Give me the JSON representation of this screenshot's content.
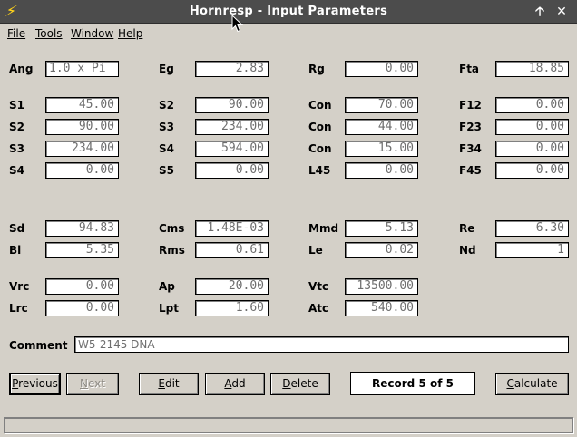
{
  "window": {
    "title": "Hornresp - Input Parameters",
    "maximize_glyph": "🡡",
    "close_glyph": "✕"
  },
  "menu": [
    "File",
    "Tools",
    "Window",
    "Help"
  ],
  "fields": {
    "Ang": "1.0 x Pi",
    "Eg": "2.83",
    "Rg": "0.00",
    "Fta": "18.85",
    "S1": "45.00",
    "S2a": "90.00",
    "Con1": "70.00",
    "F12": "0.00",
    "S2": "90.00",
    "S3a": "234.00",
    "Con2": "44.00",
    "F23": "0.00",
    "S3": "234.00",
    "S4a": "594.00",
    "Con3": "15.00",
    "F34": "0.00",
    "S4": "0.00",
    "S5": "0.00",
    "L45": "0.00",
    "F45": "0.00",
    "Sd": "94.83",
    "Cms": "1.48E-03",
    "Mmd": "5.13",
    "Re": "6.30",
    "Bl": "5.35",
    "Rms": "0.61",
    "Le": "0.02",
    "Nd": "1",
    "Vrc": "0.00",
    "Ap": "20.00",
    "Vtc": "13500.00",
    "Lrc": "0.00",
    "Lpt": "1.60",
    "Atc": "540.00",
    "Comment": "W5-2145 DNA"
  },
  "labels": {
    "Ang": "Ang",
    "Eg": "Eg",
    "Rg": "Rg",
    "Fta": "Fta",
    "S1": "S1",
    "S2a": "S2",
    "Con1": "Con",
    "F12": "F12",
    "S2": "S2",
    "S3a": "S3",
    "Con2": "Con",
    "F23": "F23",
    "S3": "S3",
    "S4a": "S4",
    "Con3": "Con",
    "F34": "F34",
    "S4": "S4",
    "S5": "S5",
    "L45": "L45",
    "F45": "F45",
    "Sd": "Sd",
    "Cms": "Cms",
    "Mmd": "Mmd",
    "Re": "Re",
    "Bl": "Bl",
    "Rms": "Rms",
    "Le": "Le",
    "Nd": "Nd",
    "Vrc": "Vrc",
    "Ap": "Ap",
    "Vtc": "Vtc",
    "Lrc": "Lrc",
    "Lpt": "Lpt",
    "Atc": "Atc",
    "Comment": "Comment"
  },
  "buttons": {
    "previous": {
      "u": "P",
      "rest": "revious"
    },
    "next": {
      "u": "N",
      "rest": "ext"
    },
    "edit": {
      "u": "E",
      "rest": "dit"
    },
    "add": {
      "u": "A",
      "rest": "dd"
    },
    "delete": {
      "u": "D",
      "rest": "elete"
    },
    "calculate": {
      "u": "C",
      "rest": "alculate"
    }
  },
  "record_text": "Record 5 of 5",
  "colors": {
    "title_bg": "#4c4c4c",
    "window_bg": "#d4d0c8",
    "field_text": "#6e6e6e",
    "icon": "#ffd21a"
  }
}
